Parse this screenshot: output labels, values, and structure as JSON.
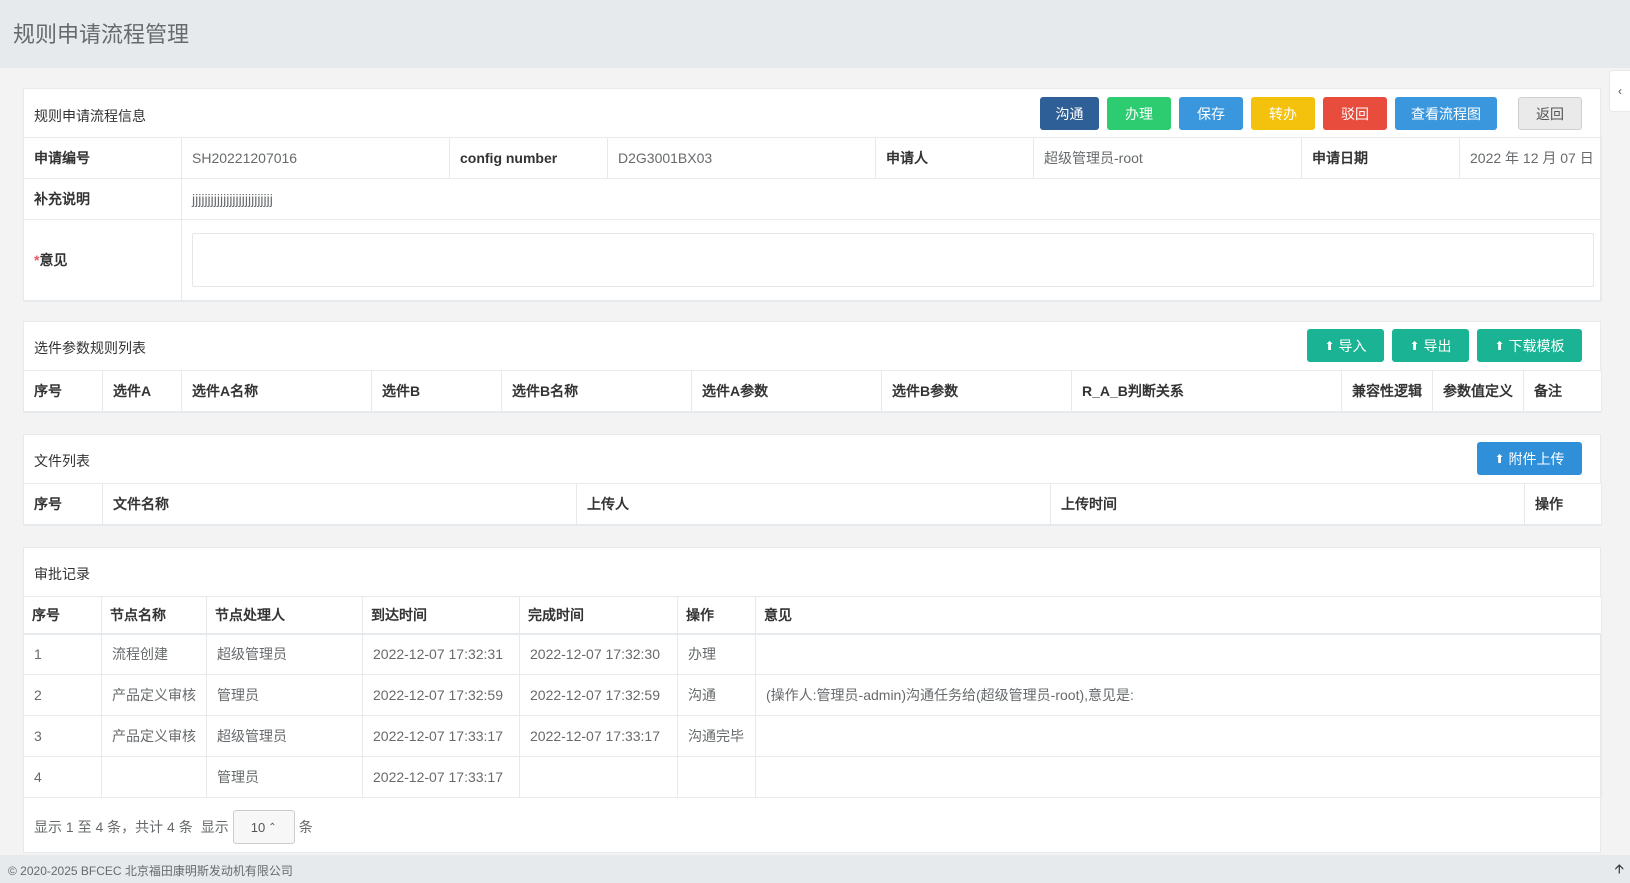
{
  "page": {
    "title": "规则申请流程管理"
  },
  "info": {
    "title": "规则申请流程信息",
    "buttons": {
      "communicate": "沟通",
      "handle": "办理",
      "save": "保存",
      "transfer": "转办",
      "reject": "驳回",
      "flowchart": "查看流程图",
      "back": "返回"
    },
    "fields": {
      "apply_no_label": "申请编号",
      "apply_no": "SH20221207016",
      "config_label": "config number",
      "config": "D2G3001BX03",
      "applicant_label": "申请人",
      "applicant": "超级管理员-root",
      "date_label": "申请日期",
      "date": "2022 年 12 月 07 日",
      "note_label": "补充说明",
      "note": "jjjjjjjjjjjjjjjjjjjjjjjjjj",
      "opinion_required": "*",
      "opinion_label": "意见",
      "opinion_value": ""
    }
  },
  "rules": {
    "title": "选件参数规则列表",
    "buttons": {
      "import": "导入",
      "export": "导出",
      "template": "下载模板"
    },
    "columns": [
      "序号",
      "选件A",
      "选件A名称",
      "选件B",
      "选件B名称",
      "选件A参数",
      "选件B参数",
      "R_A_B判断关系",
      "兼容性逻辑",
      "参数值定义",
      "备注"
    ]
  },
  "files": {
    "title": "文件列表",
    "buttons": {
      "upload": "附件上传"
    },
    "columns": [
      "序号",
      "文件名称",
      "上传人",
      "上传时间",
      "操作"
    ]
  },
  "approval": {
    "title": "审批记录",
    "columns": [
      "序号",
      "节点名称",
      "节点处理人",
      "到达时间",
      "完成时间",
      "操作",
      "意见"
    ],
    "rows": [
      [
        "1",
        "流程创建",
        "超级管理员",
        "2022-12-07 17:32:31",
        "2022-12-07 17:32:30",
        "办理",
        ""
      ],
      [
        "2",
        "产品定义审核",
        "管理员",
        "2022-12-07 17:32:59",
        "2022-12-07 17:32:59",
        "沟通",
        "(操作人:管理员-admin)沟通任务给(超级管理员-root),意见是:"
      ],
      [
        "3",
        "产品定义审核",
        "超级管理员",
        "2022-12-07 17:33:17",
        "2022-12-07 17:33:17",
        "沟通完毕",
        ""
      ],
      [
        "4",
        "",
        "管理员",
        "2022-12-07 17:33:17",
        "",
        "",
        ""
      ]
    ],
    "pagination": {
      "summary": "显示 1 至 4 条，共计 4 条",
      "show": "显示",
      "page_size": "10",
      "unit": "条"
    }
  },
  "footer": {
    "text": "© 2020-2025 BFCEC 北京福田康明斯发动机有限公司"
  },
  "colors": {
    "communicate": "#2f5f97",
    "handle": "#2ecc71",
    "save": "#3a97de",
    "transfer": "#f4c20d",
    "reject": "#e74c3c",
    "flowchart": "#3a97de",
    "back": "#eaeaea",
    "teal": "#1ab394",
    "upload": "#2f8fd8"
  }
}
